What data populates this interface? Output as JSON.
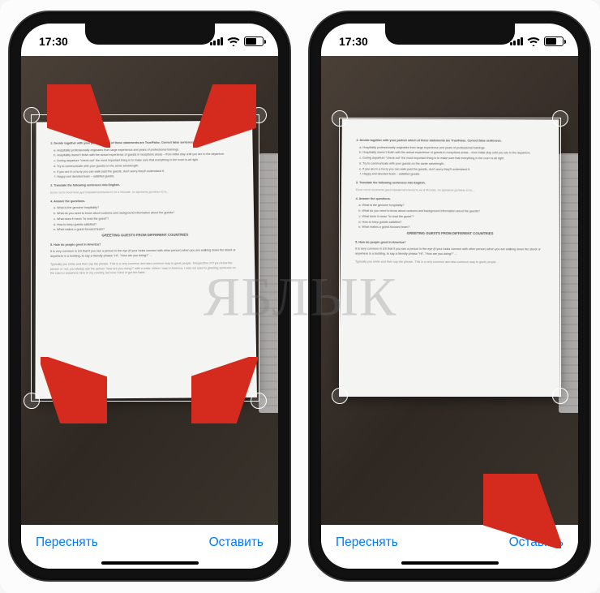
{
  "status": {
    "time": "17:30"
  },
  "toolbar": {
    "retake": "Переснять",
    "keep": "Оставить"
  },
  "icons": {
    "signal": "cellular-signal-icon",
    "wifi": "wifi-icon",
    "battery": "battery-icon"
  },
  "colors": {
    "accent": "#007aff",
    "arrow": "#d52b1e"
  },
  "document": {
    "title_hint": "GREETING GUESTS FROM DIFFERENT COUNTRIES",
    "q2": "Decide together with your partner which of these statements are True/False. Correct false sentences.",
    "q2_items": [
      "Hospitality professionally originates from large experience and years of professional trainings.",
      "Hospitality doesn't finish with the actual experience of guests in receptions areas – from initial stay until you are in the departure.",
      "During departure \"check-out\" the most important thing is to make sure that everything in the room is all right.",
      "Try to communicate with your guests on the same wavelength.",
      "If you are in a hurry you can walk past the guests, don't worry they'll understand it.",
      "Happy and devoted team – satisfied guests."
    ],
    "q3": "Translate the following sentences into English.",
    "q4": "Answer the questions.",
    "q4_items": [
      "What is the genuine hospitality?",
      "What do you need to know about customs and background information about the guests?",
      "What does it mean \"to read the guest\"?",
      "How to keep guests satisfied?",
      "What makes a guest-focused team?"
    ],
    "q5_title": "How do people greet in America?",
    "q5_body": "It is very common in US that if you see a person in the eye (if your looks connect with other person) when you are walking down the street or anywhere in a building, to say a friendly phrase \"Hi\", \"How are you doing?\" ..."
  },
  "watermark": "ЯБЛЫК"
}
